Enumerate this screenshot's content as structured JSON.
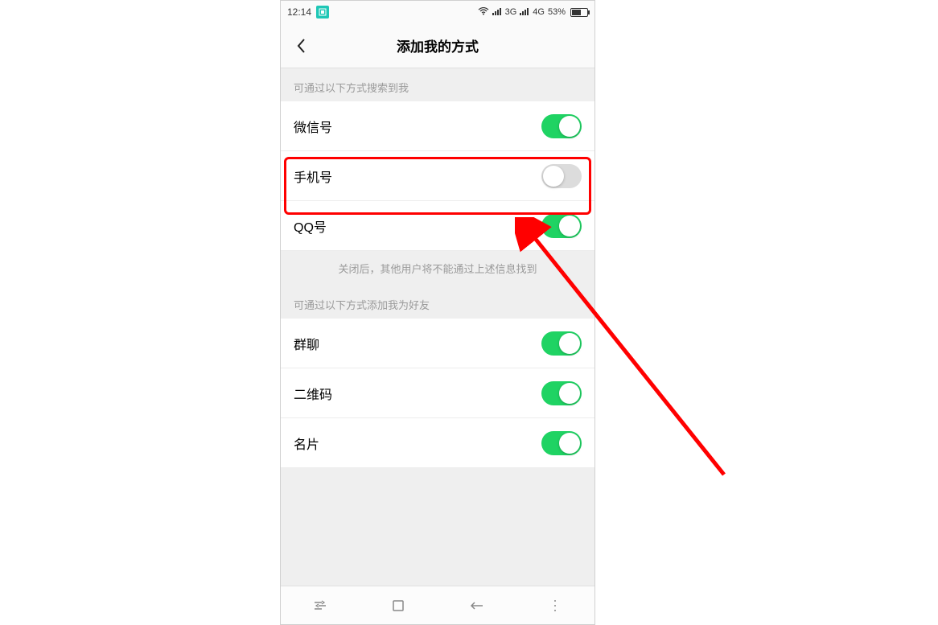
{
  "statusbar": {
    "time": "12:14",
    "network1": "3G",
    "network2": "4G",
    "battery_pct": "53%"
  },
  "header": {
    "title": "添加我的方式"
  },
  "section1": {
    "label": "可通过以下方式搜索到我",
    "rows": [
      {
        "label": "微信号",
        "on": true
      },
      {
        "label": "手机号",
        "on": false
      },
      {
        "label": "QQ号",
        "on": true
      }
    ],
    "note": "关闭后，其他用户将不能通过上述信息找到"
  },
  "section2": {
    "label": "可通过以下方式添加我为好友",
    "rows": [
      {
        "label": "群聊",
        "on": true
      },
      {
        "label": "二维码",
        "on": true
      },
      {
        "label": "名片",
        "on": true
      }
    ]
  },
  "highlight": {
    "target_row_index": 1
  }
}
